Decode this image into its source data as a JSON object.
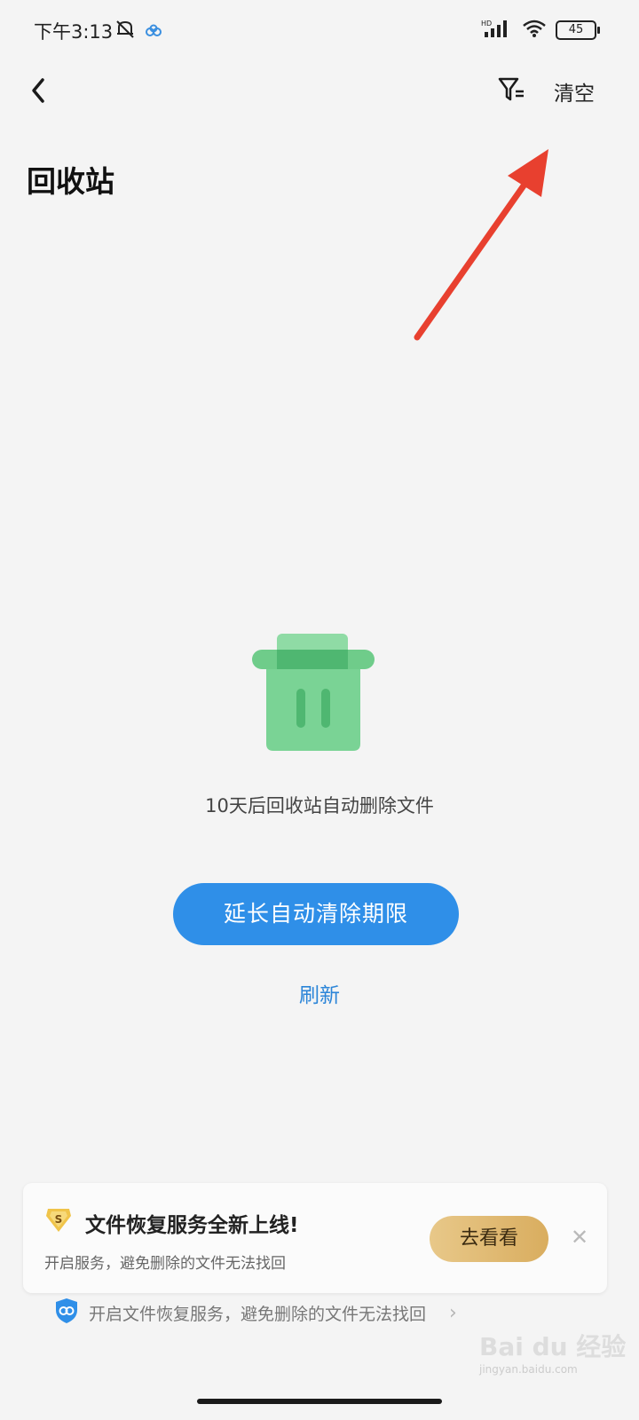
{
  "status_bar": {
    "time": "下午3:13",
    "network": "HD",
    "battery": "45"
  },
  "header": {
    "back_icon": "chevron-left-icon",
    "filter_icon": "filter-icon",
    "clear_label": "清空"
  },
  "page_title": "回收站",
  "empty_state": {
    "illustration_icon": "trash-icon",
    "message": "10天后回收站自动删除文件",
    "primary_button": "延长自动清除期限",
    "refresh_link": "刷新"
  },
  "promo": {
    "badge_icon": "dollar-shield-icon",
    "title": "文件恢复服务全新上线!",
    "subtitle": "开启服务，避免删除的文件无法找回",
    "cta": "去看看",
    "close_icon": "close-icon"
  },
  "hint": {
    "icon": "shield-link-icon",
    "text": "开启文件恢复服务，避免删除的文件无法找回"
  },
  "watermark": {
    "brand": "Bai du 经验",
    "url": "jingyan.baidu.com"
  },
  "colors": {
    "primary_blue": "#2f8fe8",
    "link_blue": "#2b85d8",
    "trash_green": "#58c47a",
    "cta_gold": "#d9ad5f",
    "annotation_red": "#e8402f"
  }
}
